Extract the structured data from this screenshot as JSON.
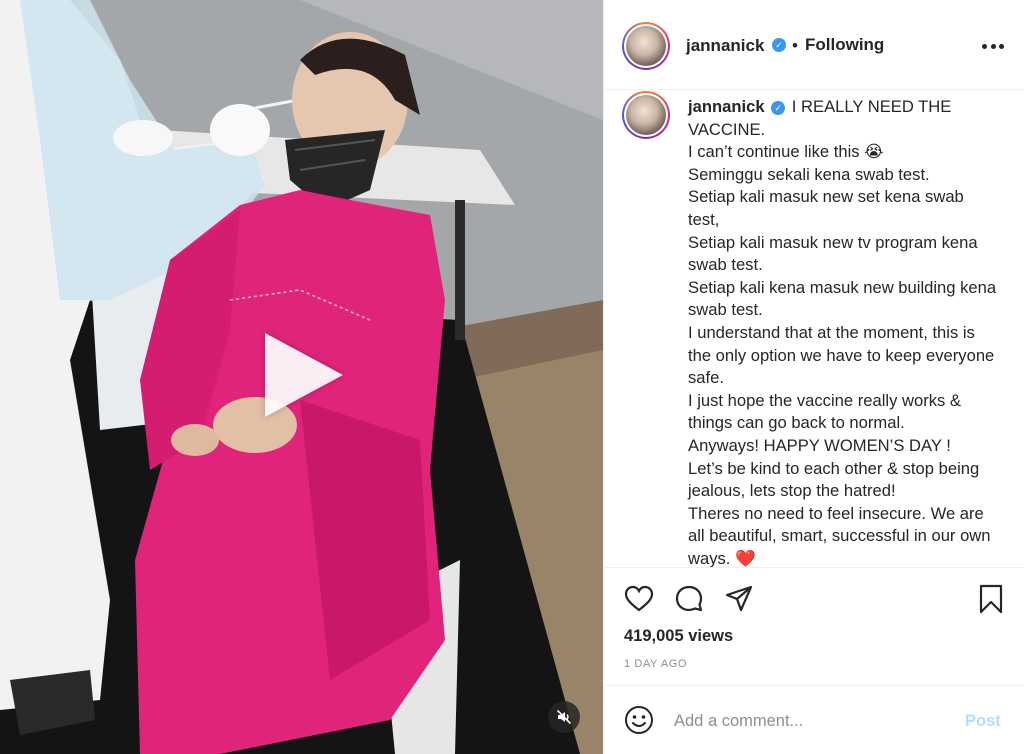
{
  "post": {
    "username": "jannanick",
    "verified": true,
    "follow_status": "Following",
    "dot_separator": "•"
  },
  "caption": {
    "username": "jannanick",
    "text": "I REALLY NEED THE VACCINE.\nI can’t continue like this 😭\nSeminggu sekali kena swab test.\nSetiap kali masuk new set kena swab test,\nSetiap kali masuk new tv program kena swab test.\nSetiap kali kena masuk new building kena swab test.\nI understand that at the moment, this is the only option we have to keep everyone safe.\nI just hope the vaccine really works & things can go back to normal.\nAnyways! HAPPY WOMEN’S DAY !\nLet’s be kind to each other & stop being jealous, lets stop the hatred!\nTheres no need to feel insecure. We are all beautiful, smart, successful in our own ways. ❤️"
  },
  "stats": {
    "views": "419,005 views",
    "timestamp": "1 DAY AGO"
  },
  "comment": {
    "placeholder": "Add a comment...",
    "post_label": "Post"
  },
  "icons": {
    "like": "heart-icon",
    "comment": "comment-icon",
    "share": "paper-plane-icon",
    "save": "bookmark-icon",
    "emoji": "emoji-icon",
    "mute": "speaker-muted-icon",
    "play": "play-icon",
    "more": "more-options-icon"
  },
  "colors": {
    "verified": "#3897f0",
    "post_button_disabled": "#b2dffc",
    "secondary_text": "#8e8e8e",
    "robe": "#e0247a"
  }
}
